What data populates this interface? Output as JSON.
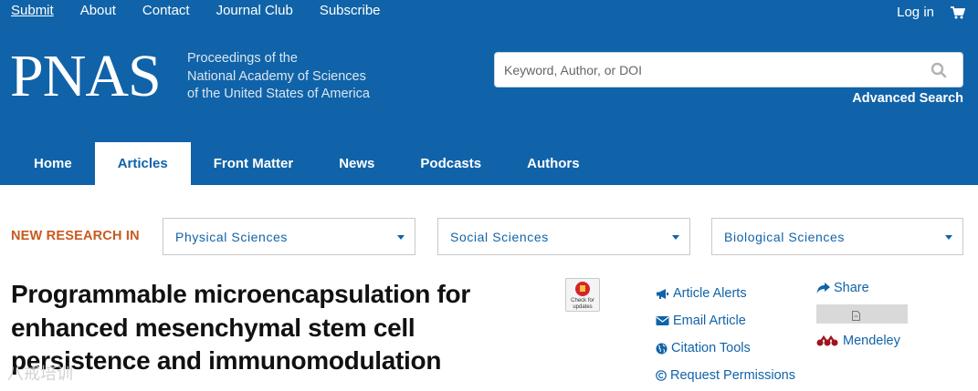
{
  "utility_nav": {
    "items": [
      "Submit",
      "About",
      "Contact",
      "Journal Club",
      "Subscribe"
    ]
  },
  "account": {
    "login_label": "Log in",
    "cart_icon": "shopping-cart-icon"
  },
  "branding": {
    "logo": "PNAS",
    "tagline_lines": [
      "Proceedings of the",
      "National Academy of Sciences",
      "of the United States of America"
    ]
  },
  "search": {
    "placeholder": "Keyword, Author, or DOI",
    "value": "",
    "icon": "search-icon",
    "advanced_label": "Advanced Search"
  },
  "main_nav": {
    "tabs": [
      {
        "label": "Home",
        "active": false
      },
      {
        "label": "Articles",
        "active": true
      },
      {
        "label": "Front Matter",
        "active": false
      },
      {
        "label": "News",
        "active": false
      },
      {
        "label": "Podcasts",
        "active": false
      },
      {
        "label": "Authors",
        "active": false
      }
    ]
  },
  "research_filter": {
    "label": "NEW RESEARCH IN",
    "selects": [
      {
        "selected": "Physical Sciences"
      },
      {
        "selected": "Social Sciences"
      },
      {
        "selected": "Biological Sciences"
      }
    ]
  },
  "article": {
    "title_lines": [
      "Programmable microencapsulation for",
      "enhanced mesenchymal stem cell",
      "persistence and immunomodulation"
    ],
    "crossmark_text": [
      "Check for",
      "updates"
    ]
  },
  "article_tools": {
    "items": [
      {
        "label": "Article Alerts",
        "icon": "megaphone-icon"
      },
      {
        "label": "Email Article",
        "icon": "envelope-icon"
      },
      {
        "label": "Citation Tools",
        "icon": "globe-icon"
      },
      {
        "label": "Request Permissions",
        "icon": "copyright-icon"
      }
    ],
    "share_label": "Share",
    "mendeley_label": "Mendeley"
  },
  "colors": {
    "brand_blue": "#1063a8",
    "accent_orange": "#c85a1e"
  },
  "watermark": "八戒培训"
}
